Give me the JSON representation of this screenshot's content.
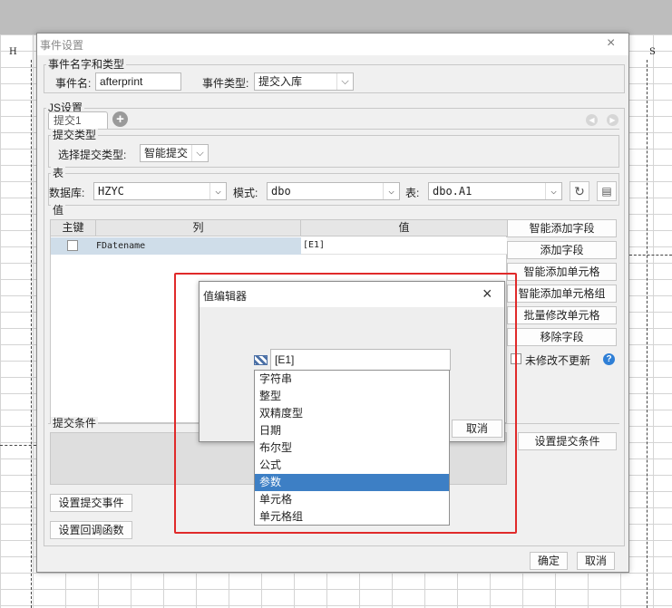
{
  "background": {
    "column_h": "H",
    "column_s": "S"
  },
  "dialog": {
    "title": "事件设置",
    "close_icon": "×",
    "event_group_legend": "事件名字和类型",
    "event_name_label": "事件名:",
    "event_name_value": "afterprint",
    "event_type_label": "事件类型:",
    "event_type_value": "提交入库",
    "js_group_legend": "JS设置",
    "tab_label": "提交1",
    "submit_type_legend": "提交类型",
    "choose_submit_type_label": "选择提交类型:",
    "submit_type_value": "智能提交",
    "table_legend": "表",
    "database_label": "数据库:",
    "database_value": "HZYC",
    "schema_label": "模式:",
    "schema_value": "dbo",
    "table_label": "表:",
    "table_value": "dbo.A1",
    "value_legend": "值",
    "table_headers": [
      "主键",
      "列",
      "值"
    ],
    "rows": [
      {
        "column": "FDatename",
        "value": "[E1]"
      }
    ],
    "side_buttons": [
      "智能添加字段",
      "添加字段",
      "智能添加单元格",
      "智能添加单元格组",
      "批量修改单元格",
      "移除字段"
    ],
    "not_modified_label": "未修改不更新",
    "submit_condition_legend": "提交条件",
    "set_submit_condition": "设置提交条件",
    "set_submit_event": "设置提交事件",
    "set_callback": "设置回调函数",
    "ok": "确定",
    "cancel": "取消"
  },
  "value_editor": {
    "title": "值编辑器",
    "close_icon": "×",
    "current_value": "[E1]",
    "cancel": "取消",
    "options": [
      "字符串",
      "整型",
      "双精度型",
      "日期",
      "布尔型",
      "公式",
      "参数",
      "单元格",
      "单元格组"
    ],
    "selected_option": "参数"
  },
  "colors": {
    "highlight": "#e02a2a",
    "selection": "#3d7fc5",
    "row_selected": "#cfdde9"
  }
}
